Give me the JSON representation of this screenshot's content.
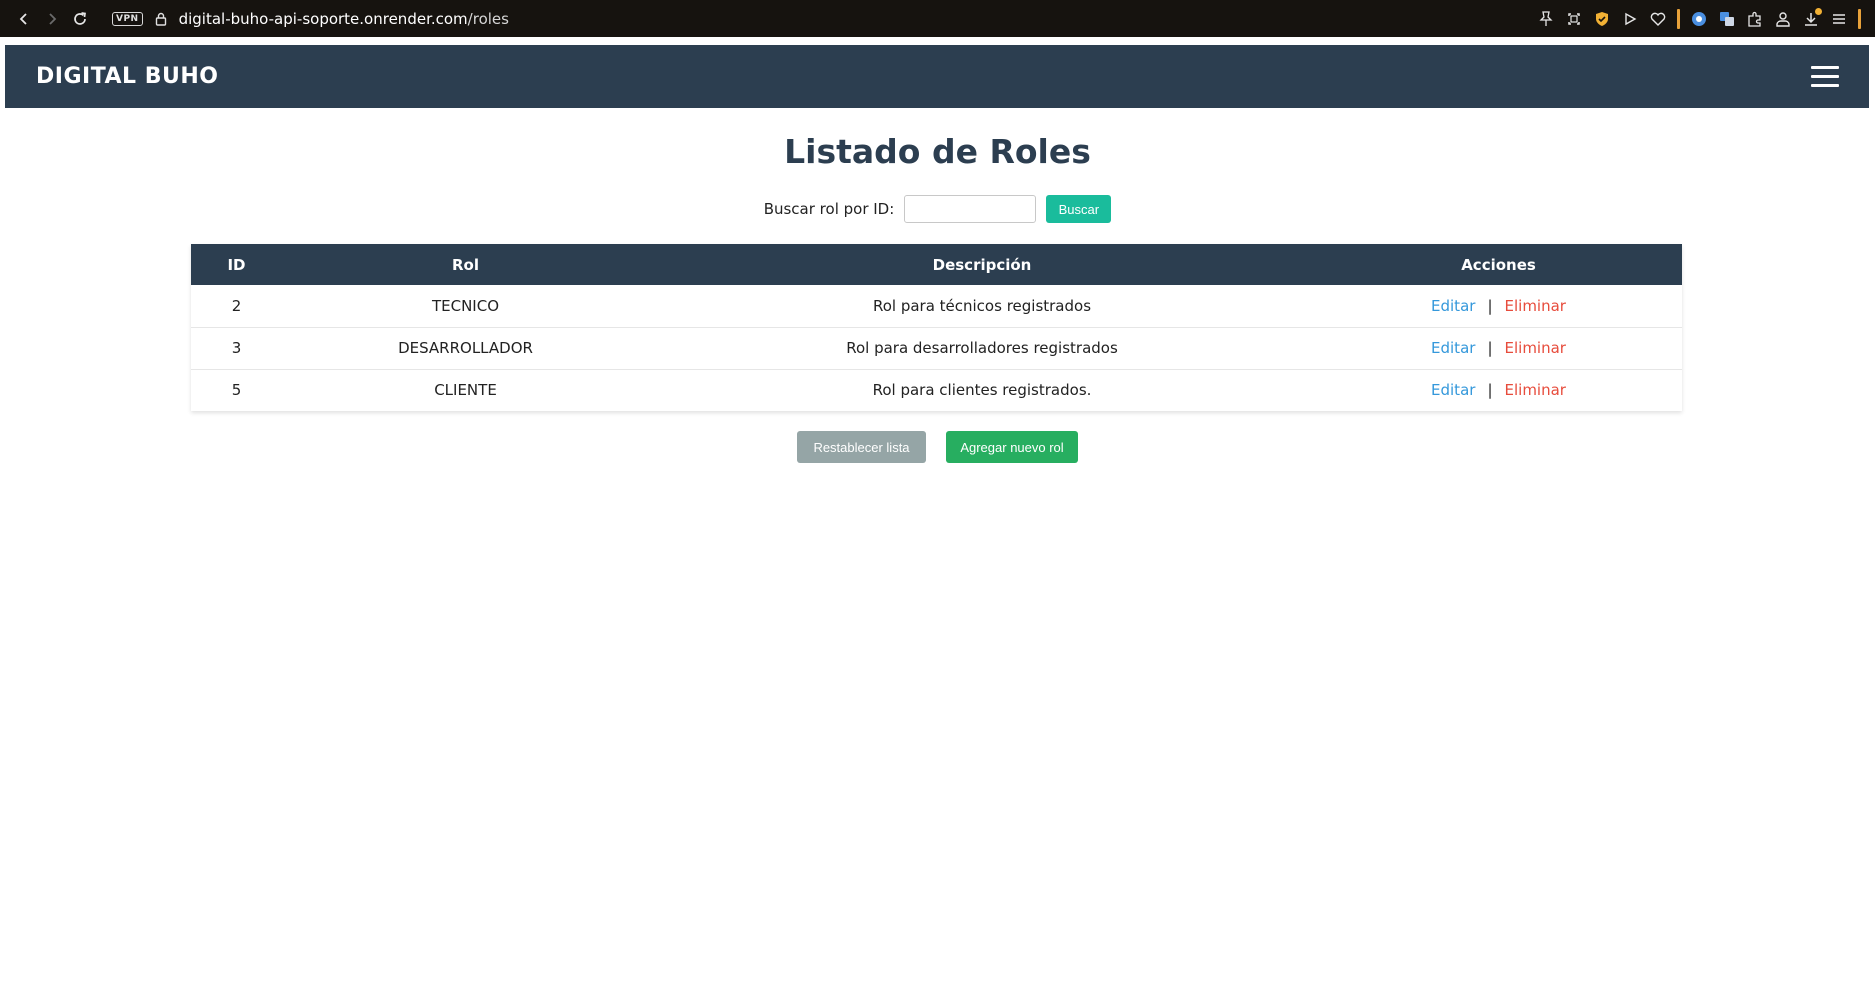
{
  "browser": {
    "url_host": "digital-buho-api-soporte.onrender.com",
    "url_path": "/roles",
    "vpn_label": "VPN"
  },
  "navbar": {
    "brand": "DIGITAL BUHO"
  },
  "page": {
    "title": "Listado de Roles"
  },
  "search": {
    "label": "Buscar rol por ID:",
    "value": "",
    "placeholder": "",
    "button_label": "Buscar"
  },
  "table": {
    "headers": [
      "ID",
      "Rol",
      "Descripción",
      "Acciones"
    ],
    "rows": [
      {
        "id": "2",
        "rol": "TECNICO",
        "descripcion": "Rol para técnicos registrados",
        "edit": "Editar",
        "sep": "|",
        "delete": "Eliminar"
      },
      {
        "id": "3",
        "rol": "DESARROLLADOR",
        "descripcion": "Rol para desarrolladores registrados",
        "edit": "Editar",
        "sep": "|",
        "delete": "Eliminar"
      },
      {
        "id": "5",
        "rol": "CLIENTE",
        "descripcion": "Rol para clientes registrados.",
        "edit": "Editar",
        "sep": "|",
        "delete": "Eliminar"
      }
    ]
  },
  "actions": {
    "reset_label": "Restablecer lista",
    "add_label": "Agregar nuevo rol"
  },
  "colors": {
    "navbar_bg": "#2c3e50",
    "search_button": "#1abc9c",
    "reset_button": "#95a5a6",
    "add_button": "#27ae60",
    "edit_link": "#3498db",
    "delete_link": "#e74c3c"
  }
}
